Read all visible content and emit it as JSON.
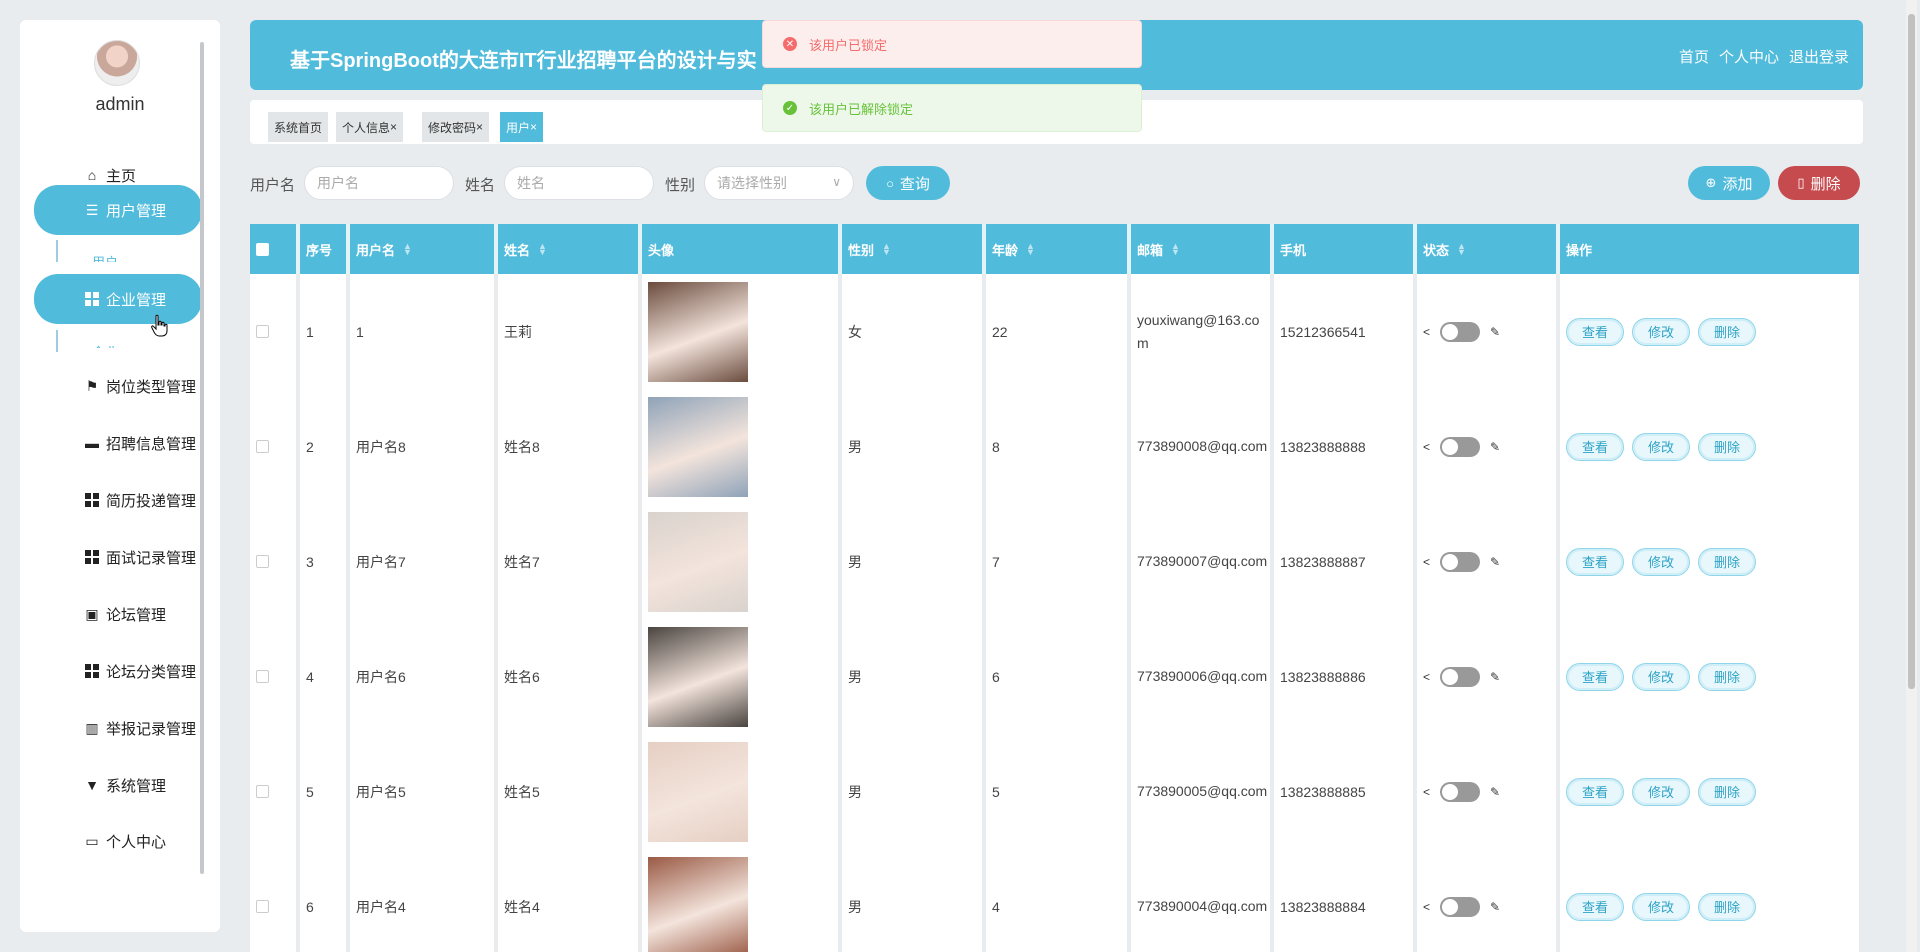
{
  "sidebar": {
    "username": "admin",
    "items": [
      {
        "label": "主页",
        "icon": "home-icon"
      },
      {
        "label": "用户管理",
        "icon": "list-icon",
        "sub": "用户"
      },
      {
        "label": "企业管理",
        "icon": "grid-icon",
        "sub": "企业"
      },
      {
        "label": "岗位类型管理",
        "icon": "flag-icon"
      },
      {
        "label": "招聘信息管理",
        "icon": "ticket-icon"
      },
      {
        "label": "简历投递管理",
        "icon": "grid-icon"
      },
      {
        "label": "面试记录管理",
        "icon": "grid-icon"
      },
      {
        "label": "论坛管理",
        "icon": "briefcase-icon"
      },
      {
        "label": "论坛分类管理",
        "icon": "grid-icon"
      },
      {
        "label": "举报记录管理",
        "icon": "book-icon"
      },
      {
        "label": "系统管理",
        "icon": "brush-icon"
      },
      {
        "label": "个人中心",
        "icon": "card-icon"
      }
    ]
  },
  "header": {
    "title": "基于SpringBoot的大连市IT行业招聘平台的设计与实",
    "links": [
      "首页",
      "个人中心",
      "退出登录"
    ]
  },
  "toasts": {
    "error": "该用户已锁定",
    "success": "该用户已解除锁定"
  },
  "tabs": [
    "系统首页",
    "个人信息",
    "修改密码",
    "用户"
  ],
  "search": {
    "username_label": "用户名",
    "username_placeholder": "用户名",
    "name_label": "姓名",
    "name_placeholder": "姓名",
    "gender_label": "性别",
    "gender_placeholder": "请选择性别",
    "query_label": "查询",
    "add_label": "添加",
    "delete_label": "删除"
  },
  "table": {
    "headers": [
      "序号",
      "用户名",
      "姓名",
      "头像",
      "性别",
      "年龄",
      "邮箱",
      "手机",
      "状态",
      "操作"
    ],
    "actions": [
      "查看",
      "修改",
      "删除"
    ],
    "rows": [
      {
        "no": "1",
        "username": "1",
        "name": "王莉",
        "gender": "女",
        "age": "22",
        "email": "youxiwang@163.com",
        "phone": "15212366541",
        "photo_color": "#6b4c3e"
      },
      {
        "no": "2",
        "username": "用户名8",
        "name": "姓名8",
        "gender": "男",
        "age": "8",
        "email": "773890008@qq.com",
        "phone": "13823888888",
        "photo_color": "#8fa3b8"
      },
      {
        "no": "3",
        "username": "用户名7",
        "name": "姓名7",
        "gender": "男",
        "age": "7",
        "email": "773890007@qq.com",
        "phone": "13823888887",
        "photo_color": "#d9d2cd"
      },
      {
        "no": "4",
        "username": "用户名6",
        "name": "姓名6",
        "gender": "男",
        "age": "6",
        "email": "773890006@qq.com",
        "phone": "13823888886",
        "photo_color": "#4a4440"
      },
      {
        "no": "5",
        "username": "用户名5",
        "name": "姓名5",
        "gender": "男",
        "age": "5",
        "email": "773890005@qq.com",
        "phone": "13823888885",
        "photo_color": "#e6cfc3"
      },
      {
        "no": "6",
        "username": "用户名4",
        "name": "姓名4",
        "gender": "男",
        "age": "4",
        "email": "773890004@qq.com",
        "phone": "13823888884",
        "photo_color": "#9a5a45"
      }
    ]
  },
  "colors": {
    "accent": "#50bbdb",
    "danger": "#c64b4e"
  }
}
